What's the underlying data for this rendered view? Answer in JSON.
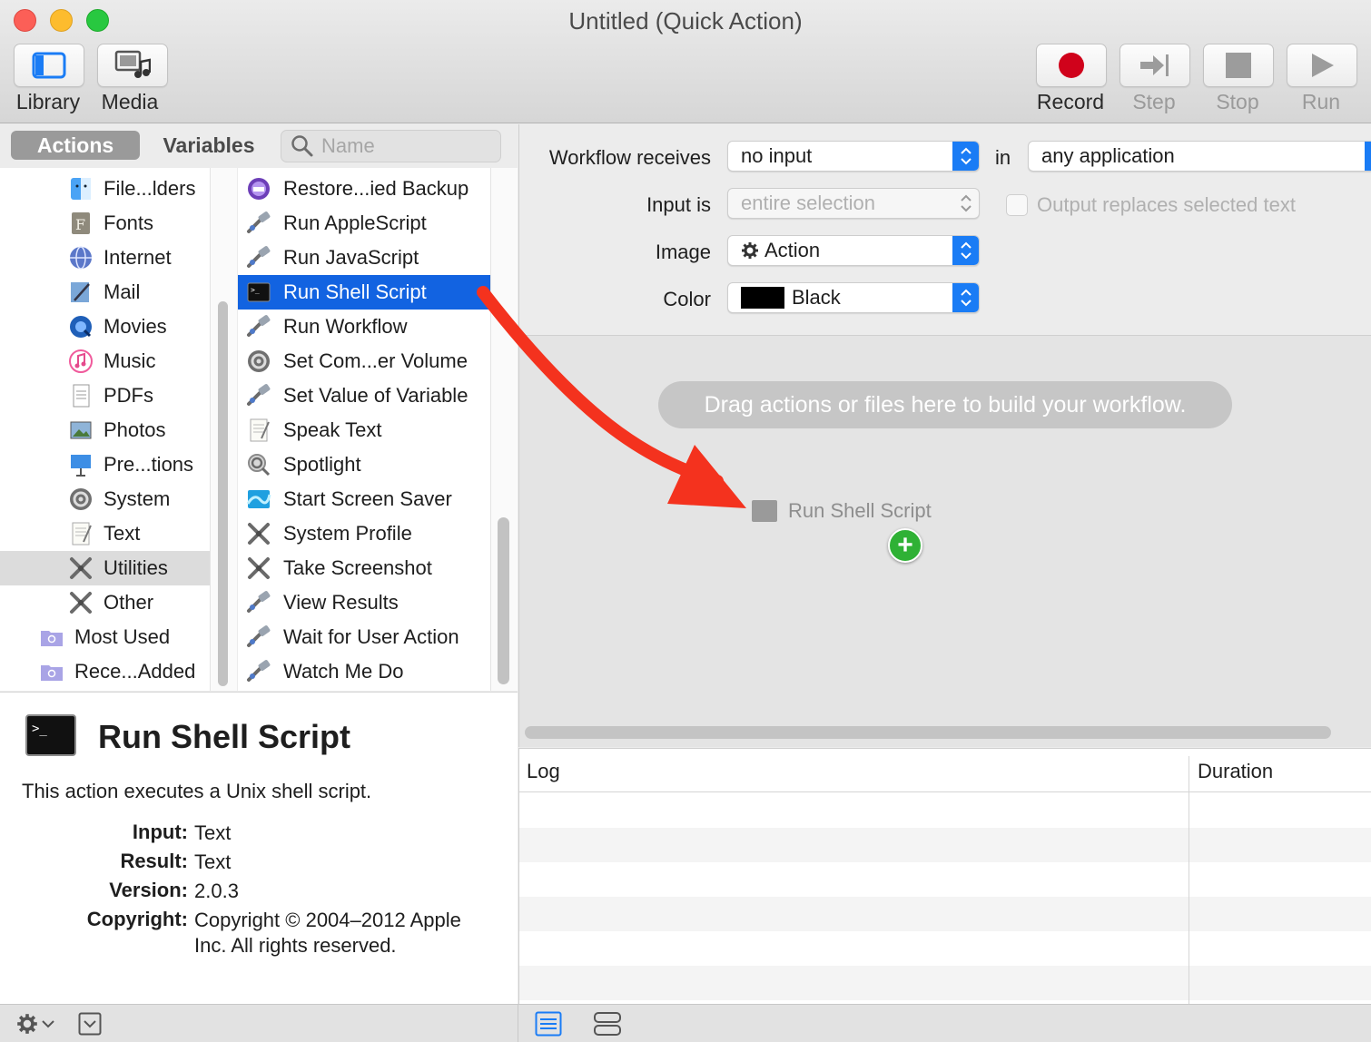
{
  "window": {
    "title": "Untitled (Quick Action)"
  },
  "toolbar": {
    "library_label": "Library",
    "media_label": "Media",
    "record_label": "Record",
    "step_label": "Step",
    "stop_label": "Stop",
    "run_label": "Run"
  },
  "tabs": {
    "actions": "Actions",
    "variables": "Variables"
  },
  "search": {
    "placeholder": "Name"
  },
  "categories": [
    {
      "label": "File...lders",
      "icon": "finder-icon"
    },
    {
      "label": "Fonts",
      "icon": "font-book-icon"
    },
    {
      "label": "Internet",
      "icon": "globe-icon"
    },
    {
      "label": "Mail",
      "icon": "mail-icon"
    },
    {
      "label": "Movies",
      "icon": "quicktime-icon"
    },
    {
      "label": "Music",
      "icon": "music-icon"
    },
    {
      "label": "PDFs",
      "icon": "pdf-icon"
    },
    {
      "label": "Photos",
      "icon": "photos-icon"
    },
    {
      "label": "Pre...tions",
      "icon": "keynote-icon"
    },
    {
      "label": "System",
      "icon": "system-gear-icon"
    },
    {
      "label": "Text",
      "icon": "text-icon"
    },
    {
      "label": "Utilities",
      "icon": "utilities-icon",
      "selected": true
    },
    {
      "label": "Other",
      "icon": "other-icon"
    },
    {
      "label": "Most Used",
      "icon": "smart-folder-icon"
    },
    {
      "label": "Rece...Added",
      "icon": "smart-folder-icon"
    }
  ],
  "actions": [
    {
      "label": "Restore...ied Backup",
      "icon": "time-machine-icon"
    },
    {
      "label": "Run AppleScript",
      "icon": "automator-icon"
    },
    {
      "label": "Run JavaScript",
      "icon": "automator-icon"
    },
    {
      "label": "Run Shell Script",
      "icon": "terminal-icon",
      "selected": true
    },
    {
      "label": "Run Workflow",
      "icon": "automator-icon"
    },
    {
      "label": "Set Com...er Volume",
      "icon": "system-gear-icon"
    },
    {
      "label": "Set Value of Variable",
      "icon": "automator-icon"
    },
    {
      "label": "Speak Text",
      "icon": "text-icon"
    },
    {
      "label": "Spotlight",
      "icon": "spotlight-icon"
    },
    {
      "label": "Start Screen Saver",
      "icon": "screen-saver-icon"
    },
    {
      "label": "System Profile",
      "icon": "utilities-icon"
    },
    {
      "label": "Take Screenshot",
      "icon": "utilities-icon"
    },
    {
      "label": "View Results",
      "icon": "automator-icon"
    },
    {
      "label": "Wait for User Action",
      "icon": "automator-icon"
    },
    {
      "label": "Watch Me Do",
      "icon": "automator-icon"
    }
  ],
  "description": {
    "title": "Run Shell Script",
    "text": "This action executes a Unix shell script.",
    "input_key": "Input:",
    "input_val": "Text",
    "result_key": "Result:",
    "result_val": "Text",
    "version_key": "Version:",
    "version_val": "2.0.3",
    "copyright_key": "Copyright:",
    "copyright_val": "Copyright © 2004–2012 Apple Inc.  All rights reserved."
  },
  "config": {
    "receives_label": "Workflow receives",
    "receives_value": "no input",
    "in_label": "in",
    "app_value": "any application",
    "input_is_label": "Input is",
    "input_is_value": "entire selection",
    "output_replaces_label": "Output replaces selected text",
    "image_label": "Image",
    "image_value": "Action",
    "color_label": "Color",
    "color_value": "Black",
    "color_swatch": "#000000"
  },
  "canvas": {
    "hint": "Drag actions or files here to build your workflow.",
    "drag_label": "Run Shell Script",
    "plus": "+"
  },
  "log": {
    "log_col": "Log",
    "duration_col": "Duration"
  },
  "colors": {
    "selection": "#1263e1",
    "accent": "#1a7cf5",
    "arrow": "#f4321e",
    "record": "#d0021b",
    "add": "#2fb135"
  }
}
